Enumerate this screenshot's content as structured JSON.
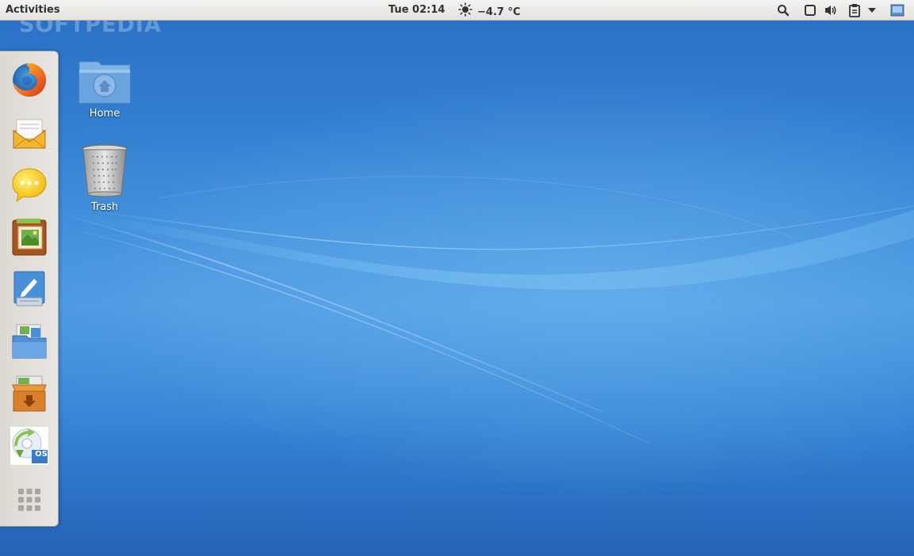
{
  "topbar": {
    "activities_label": "Activities",
    "clock": "Tue 02:14",
    "weather_icon": "sun-icon",
    "temperature": "−4.7 °C",
    "tray_icons": [
      "search-icon",
      "window-icon",
      "volume-icon",
      "clipboard-icon",
      "dropdown-arrow-icon",
      "screen-icon"
    ]
  },
  "watermark": "SOFTPEDIA",
  "desktop": {
    "icons": [
      {
        "label": "Home",
        "icon": "home-folder-icon"
      },
      {
        "label": "Trash",
        "icon": "trash-icon"
      }
    ]
  },
  "dash": {
    "items": [
      {
        "name": "firefox",
        "icon": "firefox-icon"
      },
      {
        "name": "mail",
        "icon": "mail-icon"
      },
      {
        "name": "chat",
        "icon": "chat-icon"
      },
      {
        "name": "photos",
        "icon": "photos-icon"
      },
      {
        "name": "text-editor",
        "icon": "text-editor-icon"
      },
      {
        "name": "file-manager",
        "icon": "file-manager-icon"
      },
      {
        "name": "archive",
        "icon": "archive-icon"
      },
      {
        "name": "installer",
        "icon": "installer-icon",
        "badge": "OS"
      },
      {
        "name": "show-applications",
        "icon": "app-grid-icon"
      }
    ]
  },
  "colors": {
    "wallpaper": "#2f7fd0",
    "topbar": "#e9e7e3",
    "dash": "#e3e0db"
  }
}
